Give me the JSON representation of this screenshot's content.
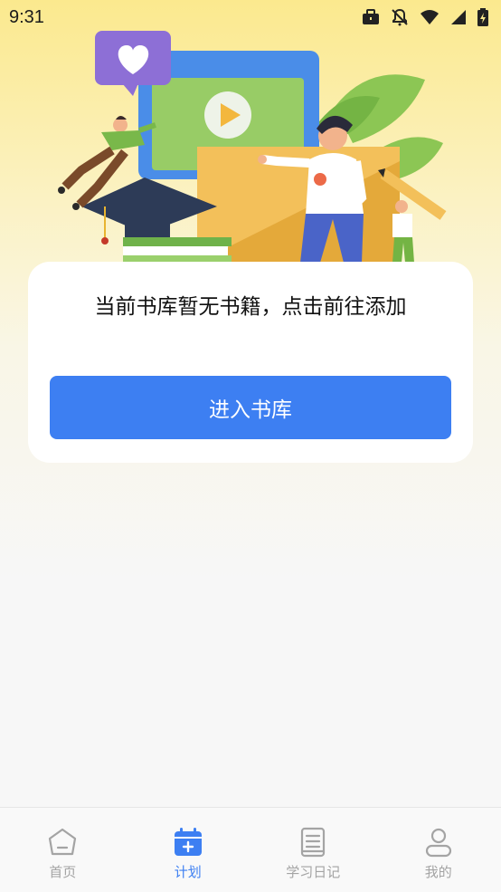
{
  "status_bar": {
    "time": "9:31",
    "icons": [
      "briefcase-icon",
      "notifications-off-icon",
      "wifi-icon",
      "signal-icon",
      "battery-charging-icon"
    ]
  },
  "empty_state": {
    "message": "当前书库暂无书籍，点击前往添加",
    "button_label": "进入书库"
  },
  "bottom_nav": {
    "items": [
      {
        "label": "首页",
        "icon": "home-icon",
        "active": false
      },
      {
        "label": "计划",
        "icon": "calendar-plus-icon",
        "active": true
      },
      {
        "label": "学习日记",
        "icon": "notebook-icon",
        "active": false
      },
      {
        "label": "我的",
        "icon": "person-icon",
        "active": false
      }
    ]
  },
  "colors": {
    "accent": "#3d7ff2",
    "inactive": "#a4a4a4",
    "gradient_top": "#fbe98e"
  }
}
